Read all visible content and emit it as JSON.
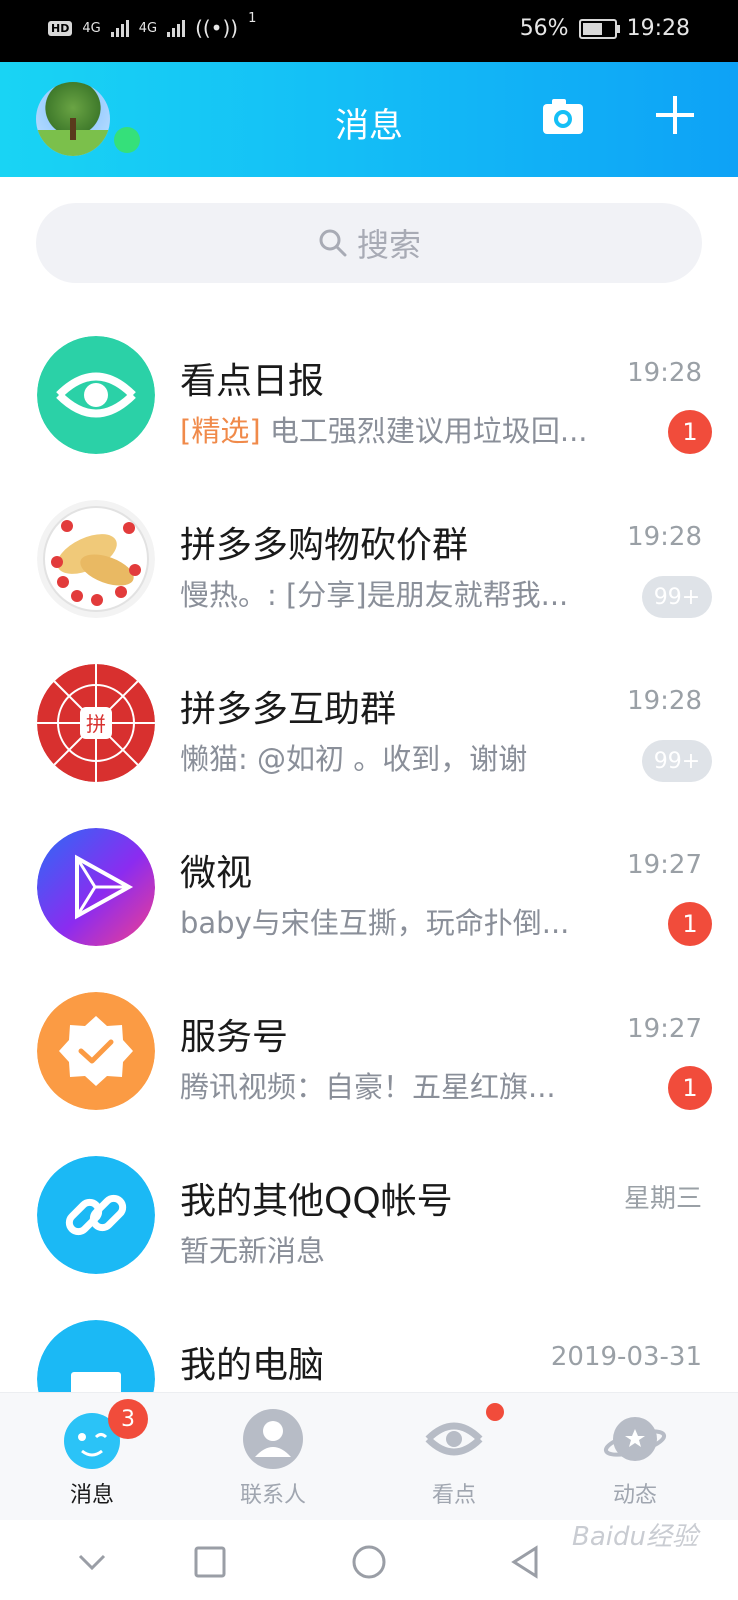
{
  "status_bar": {
    "network_1": "4G",
    "network_2": "4G",
    "hotspot_count": "1",
    "battery": "56%",
    "time": "19:28"
  },
  "header": {
    "title": "消息"
  },
  "search": {
    "placeholder": "搜索"
  },
  "conversations": [
    {
      "name": "看点日报",
      "time": "19:28",
      "tag": "[精选]",
      "preview": " 电工强烈建议用垃圾回...",
      "badge": "1",
      "badge_style": "red",
      "icon": "kandian-eye-icon",
      "color": "#2bd1a7"
    },
    {
      "name": "拼多多购物砍价群",
      "time": "19:28",
      "tag": "",
      "preview": "慢热。: [分享]是朋友就帮我...",
      "badge": "99+",
      "badge_style": "gray",
      "icon": "food-avatar",
      "color": "#f2f2f2"
    },
    {
      "name": "拼多多互助群",
      "time": "19:28",
      "tag": "",
      "preview": "懒猫: @如初 。收到，谢谢",
      "badge": "99+",
      "badge_style": "gray",
      "icon": "pinduoduo-logo",
      "color": "#d8302f"
    },
    {
      "name": "微视",
      "time": "19:27",
      "tag": "",
      "preview": "baby与宋佳互撕，玩命扑倒...",
      "badge": "1",
      "badge_style": "red",
      "icon": "weishi-play-icon",
      "color": "#7b3cf5"
    },
    {
      "name": "服务号",
      "time": "19:27",
      "tag": "",
      "preview": "腾讯视频：自豪！五星红旗...",
      "badge": "1",
      "badge_style": "red",
      "icon": "service-check-icon",
      "color": "#fb9b44"
    },
    {
      "name": "我的其他QQ帐号",
      "time": "星期三",
      "tag": "",
      "preview": "暂无新消息",
      "badge": "",
      "badge_style": "none",
      "icon": "link-icon",
      "color": "#1bb9f5"
    },
    {
      "name": "我的电脑",
      "time": "2019-03-31",
      "tag": "",
      "preview": "",
      "badge": "",
      "badge_style": "none",
      "icon": "computer-icon",
      "color": "#1bb9f5"
    }
  ],
  "tabs": [
    {
      "label": "消息",
      "badge": "3",
      "active": true
    },
    {
      "label": "联系人"
    },
    {
      "label": "看点"
    },
    {
      "label": "动态"
    }
  ],
  "watermark": "Baidu经验"
}
